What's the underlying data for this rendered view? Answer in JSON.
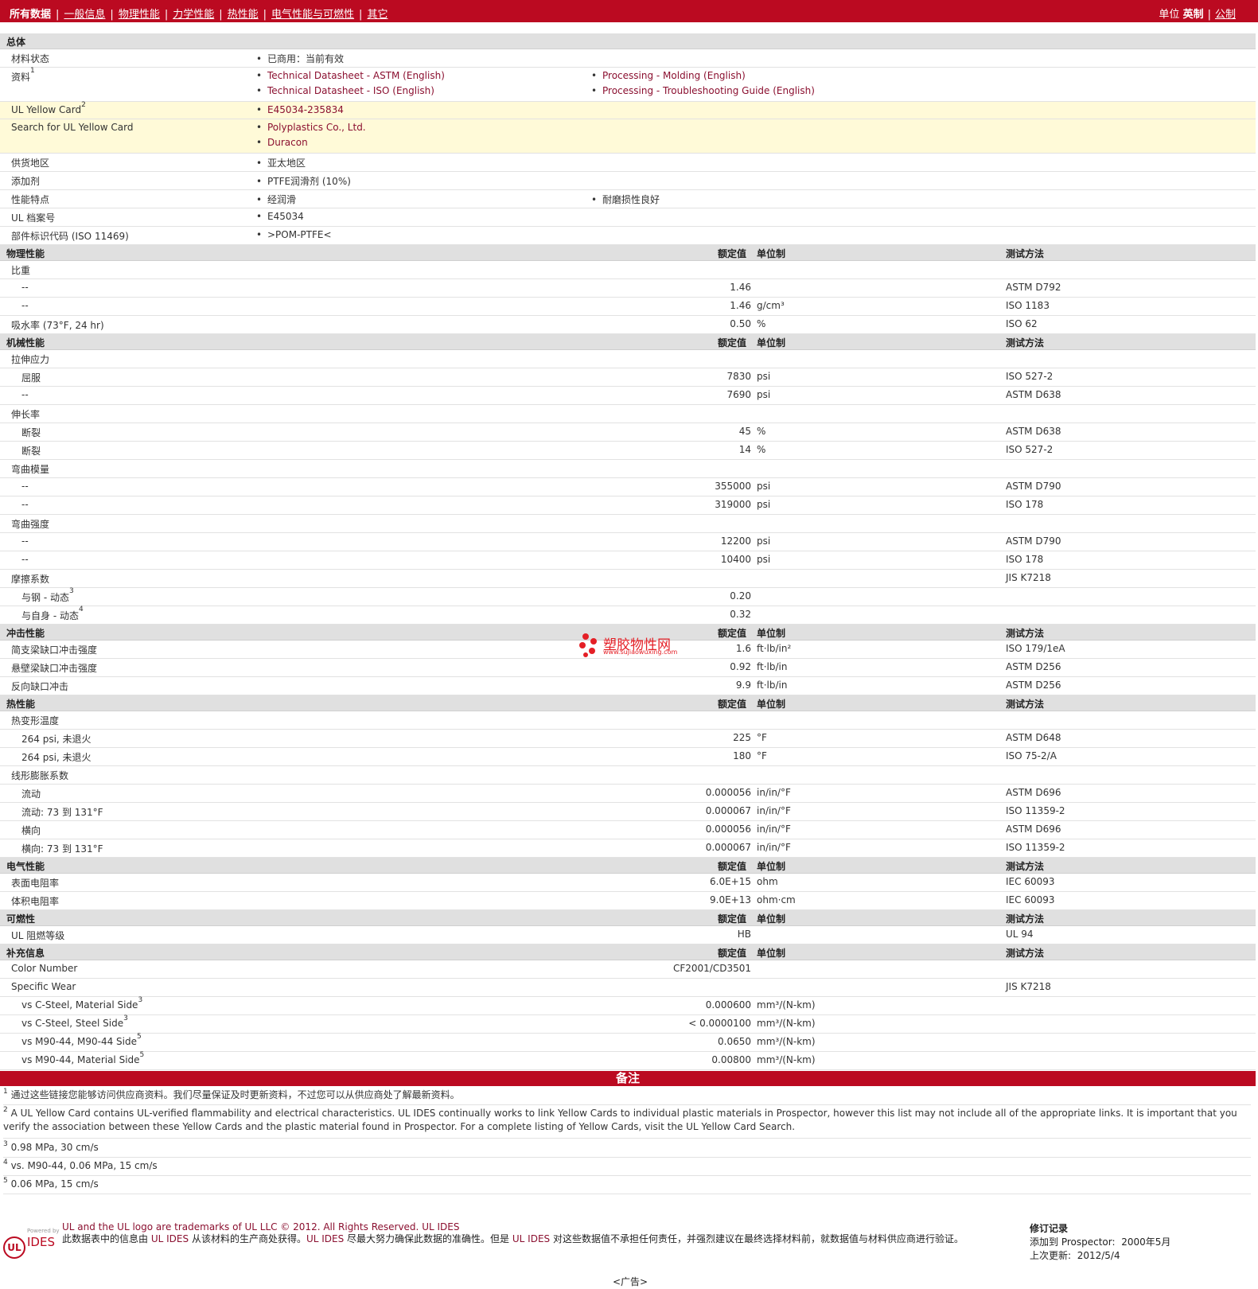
{
  "nav": {
    "active": "所有数据",
    "items": [
      "一般信息",
      "物理性能",
      "力学性能",
      "热性能",
      "电气性能与可燃性",
      "其它"
    ],
    "units_label": "单位",
    "unit_current": "英制",
    "unit_other": "公制"
  },
  "general": {
    "section": "总体",
    "status_label": "材料状态",
    "status_value": "已商用：当前有效",
    "docs_label": "资料",
    "docs_sup": "1",
    "docs": [
      "Technical Datasheet - ASTM (English)",
      "Processing - Molding (English)",
      "Technical Datasheet - ISO (English)",
      "Processing - Troubleshooting Guide (English)"
    ],
    "ulyc_label": "UL Yellow Card",
    "ulyc_sup": "2",
    "ulyc_value": "E45034-235834",
    "search_label": "Search for UL Yellow Card",
    "search_values": [
      "Polyplastics Co., Ltd.",
      "Duracon"
    ],
    "region_label": "供货地区",
    "region_value": "亚太地区",
    "additive_label": "添加剂",
    "additive_value": "PTFE润滑剂 (10%)",
    "features_label": "性能特点",
    "features": [
      "经润滑",
      "耐磨损性良好"
    ],
    "ulfile_label": "UL 档案号",
    "ulfile_value": "E45034",
    "marking_label": "部件标识代码",
    "marking_note": "(ISO 11469)",
    "marking_value": ">POM-PTFE<"
  },
  "headers": {
    "nominal": "额定值",
    "unit": "单位制",
    "method": "测试方法"
  },
  "sections": {
    "physical": "物理性能",
    "mechanical": "机械性能",
    "impact": "冲击性能",
    "thermal": "热性能",
    "electrical": "电气性能",
    "flammability": "可燃性",
    "supplemental": "补充信息"
  },
  "rows": {
    "sg": "比重",
    "sg1": {
      "label": "--",
      "value": "1.46",
      "unit": "",
      "method": "ASTM D792"
    },
    "sg2": {
      "label": "--",
      "value": "1.46",
      "unit": "g/cm³",
      "method": "ISO 1183"
    },
    "wa": {
      "label": "吸水率",
      "cond": "(73°F, 24 hr)",
      "value": "0.50",
      "unit": "%",
      "method": "ISO 62"
    },
    "ts": "拉伸应力",
    "ts1": {
      "label": "屈服",
      "value": "7830",
      "unit": "psi",
      "method": "ISO 527-2"
    },
    "ts2": {
      "label": "--",
      "value": "7690",
      "unit": "psi",
      "method": "ASTM D638"
    },
    "el": "伸长率",
    "el1": {
      "label": "断裂",
      "value": "45",
      "unit": "%",
      "method": "ASTM D638"
    },
    "el2": {
      "label": "断裂",
      "value": "14",
      "unit": "%",
      "method": "ISO 527-2"
    },
    "fm": "弯曲模量",
    "fm1": {
      "label": "--",
      "value": "355000",
      "unit": "psi",
      "method": "ASTM D790"
    },
    "fm2": {
      "label": "--",
      "value": "319000",
      "unit": "psi",
      "method": "ISO 178"
    },
    "fs": "弯曲强度",
    "fs1": {
      "label": "--",
      "value": "12200",
      "unit": "psi",
      "method": "ASTM D790"
    },
    "fs2": {
      "label": "--",
      "value": "10400",
      "unit": "psi",
      "method": "ISO 178"
    },
    "cf": {
      "label": "摩擦系数",
      "method": "JIS K7218"
    },
    "cf1": {
      "label": "与钢 - 动态",
      "sup": "3",
      "value": "0.20"
    },
    "cf2": {
      "label": "与自身 - 动态",
      "sup": "4",
      "value": "0.32"
    },
    "im1": {
      "label": "简支梁缺口冲击强度",
      "value": "1.6",
      "unit": "ft·lb/in²",
      "method": "ISO 179/1eA"
    },
    "im2": {
      "label": "悬壁梁缺口冲击强度",
      "value": "0.92",
      "unit": "ft·lb/in",
      "method": "ASTM D256"
    },
    "im3": {
      "label": "反向缺口冲击",
      "value": "9.9",
      "unit": "ft·lb/in",
      "method": "ASTM D256"
    },
    "hdt": "热变形温度",
    "hdt1": {
      "label": "264 psi, 未退火",
      "value": "225",
      "unit": "°F",
      "method": "ASTM D648"
    },
    "hdt2": {
      "label": "264 psi, 未退火",
      "value": "180",
      "unit": "°F",
      "method": "ISO 75-2/A"
    },
    "clte": "线形膨胀系数",
    "clte1": {
      "label": "流动",
      "value": "0.000056",
      "unit": "in/in/°F",
      "method": "ASTM D696"
    },
    "clte2": {
      "label": "流动: 73 到 131°F",
      "value": "0.000067",
      "unit": "in/in/°F",
      "method": "ISO 11359-2"
    },
    "clte3": {
      "label": "横向",
      "value": "0.000056",
      "unit": "in/in/°F",
      "method": "ASTM D696"
    },
    "clte4": {
      "label": "横向: 73 到 131°F",
      "value": "0.000067",
      "unit": "in/in/°F",
      "method": "ISO 11359-2"
    },
    "er1": {
      "label": "表面电阻率",
      "value": "6.0E+15",
      "unit": "ohm",
      "method": "IEC 60093"
    },
    "er2": {
      "label": "体积电阻率",
      "value": "9.0E+13",
      "unit": "ohm·cm",
      "method": "IEC 60093"
    },
    "fl1": {
      "label": "UL 阻燃等级",
      "value": "HB",
      "method": "UL 94"
    },
    "si1": {
      "label": "Color Number",
      "value": "CF2001/CD3501"
    },
    "sw": {
      "label": "Specific Wear",
      "method": "JIS K7218"
    },
    "sw1": {
      "label": "vs C-Steel, Material Side",
      "sup": "3",
      "value": "0.000600",
      "unit": "mm³/(N-km)"
    },
    "sw2": {
      "label": "vs C-Steel, Steel Side",
      "sup": "3",
      "value": "< 0.0000100",
      "unit": "mm³/(N-km)"
    },
    "sw3": {
      "label": "vs M90-44, M90-44 Side",
      "sup": "5",
      "value": "0.0650",
      "unit": "mm³/(N-km)"
    },
    "sw4": {
      "label": "vs M90-44, Material Side",
      "sup": "5",
      "value": "0.00800",
      "unit": "mm³/(N-km)"
    }
  },
  "notes": {
    "title": "备注",
    "n1_num": "1",
    "n1": "通过这些链接您能够访问供应商资料。我们尽量保证及时更新资料，不过您可以从供应商处了解最新资料。",
    "n2_num": "2",
    "n2": "A UL Yellow Card contains UL-verified flammability and electrical characteristics. UL IDES continually works to link Yellow Cards to individual plastic materials in Prospector, however this list may not include all of the appropriate links. It is important that you verify the association between these Yellow Cards and the plastic material found in Prospector. For a complete listing of Yellow Cards, visit the UL Yellow Card Search.",
    "n3_num": "3",
    "n3": "0.98 MPa, 30 cm/s",
    "n4_num": "4",
    "n4": "vs. M90-44, 0.06 MPa, 15 cm/s",
    "n5_num": "5",
    "n5": "0.06 MPa, 15 cm/s"
  },
  "footer": {
    "logo_ul": "UL",
    "powered": "Powered by",
    "ides": "IDES",
    "trademark": "UL and the UL logo are trademarks of UL LLC © 2012. All Rights Reserved.",
    "trademark_brand": "UL IDES",
    "disclaimer_a": "此数据表中的信息由",
    "disclaimer_b": "UL IDES",
    "disclaimer_c": "从该材料的生产商处获得。",
    "disclaimer_d": "UL IDES",
    "disclaimer_e": "尽最大努力确保此数据的准确性。但是",
    "disclaimer_f": "UL IDES",
    "disclaimer_g": "对这些数据值不承担任何责任，并强烈建议在最终选择材料前，就数据值与材料供应商进行验证。",
    "rev_title": "修订记录",
    "rev_added_label": "添加到",
    "rev_added_where": "Prospector:",
    "rev_added_date": "2000年5月",
    "rev_updated_label": "上次更新:",
    "rev_updated_date": "2012/5/4",
    "ad": "<广告>"
  },
  "watermark": {
    "text": "塑胶物性网",
    "url": "www.sujiaowuxing.com"
  },
  "colors": {
    "brand_red": "#bb0a21",
    "link": "#8b1030",
    "highlight": "#fffad8",
    "section_bg": "#e0e0e0"
  }
}
